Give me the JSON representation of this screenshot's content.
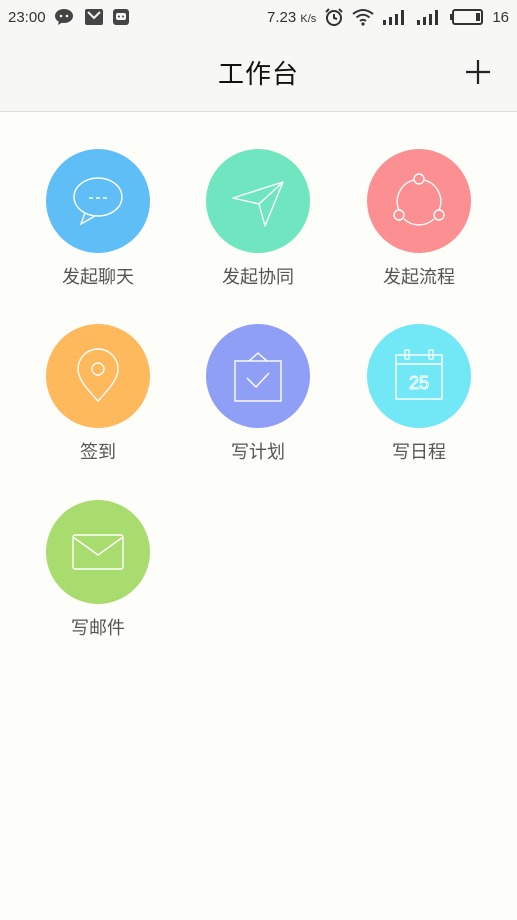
{
  "status_bar": {
    "time": "23:00",
    "speed": "7.23",
    "speed_unit": "K/s",
    "battery": "16"
  },
  "header": {
    "title": "工作台",
    "add_icon": "plus-icon"
  },
  "tiles": [
    {
      "label": "发起聊天",
      "icon": "chat-bubble-icon",
      "color": "#5fbef5"
    },
    {
      "label": "发起协同",
      "icon": "paper-plane-icon",
      "color": "#6fe6bf"
    },
    {
      "label": "发起流程",
      "icon": "flow-cycle-icon",
      "color": "#fc8f91"
    },
    {
      "label": "签到",
      "icon": "location-pin-icon",
      "color": "#fdb95c"
    },
    {
      "label": "写计划",
      "icon": "plan-bag-check-icon",
      "color": "#8f9ff5"
    },
    {
      "label": "写日程",
      "icon": "calendar-icon",
      "color": "#72e7f5"
    },
    {
      "label": "写邮件",
      "icon": "envelope-icon",
      "color": "#a9dc6e"
    }
  ],
  "calendar_day": "25"
}
